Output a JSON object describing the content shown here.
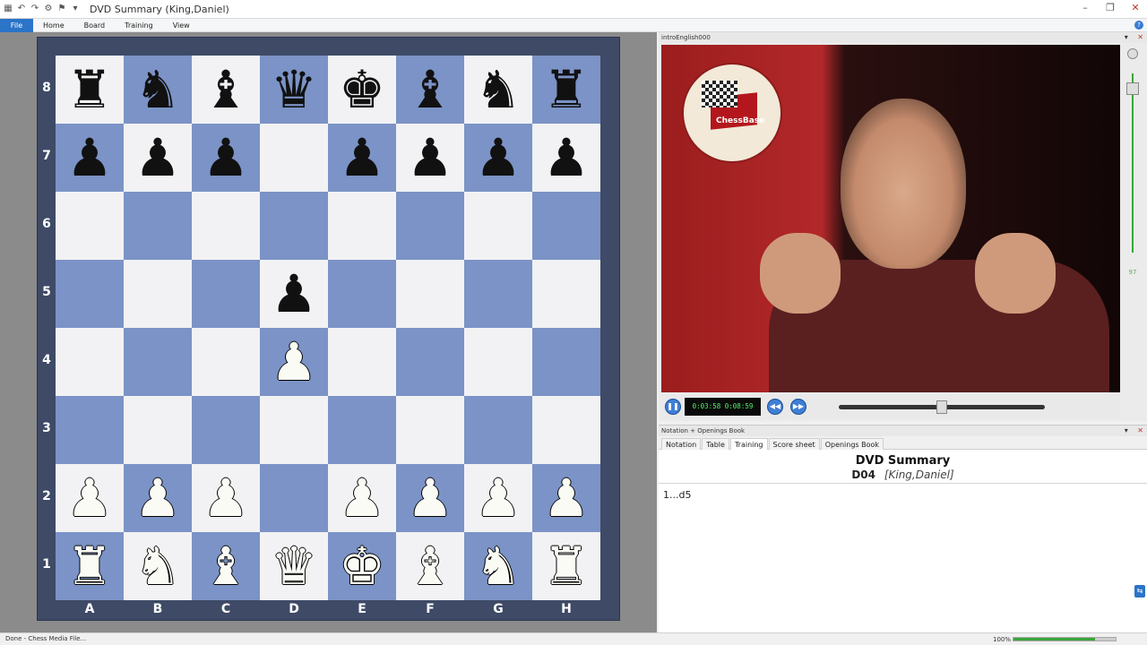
{
  "window": {
    "title": "DVD Summary  (King,Daniel)",
    "controls": [
      "minimize-icon",
      "restore-icon",
      "close-icon"
    ]
  },
  "quick_access": [
    "chessboard-icon",
    "undo-icon",
    "redo-icon",
    "engine-icon",
    "flag-icon",
    "dropdown-icon"
  ],
  "menu": {
    "items": [
      "File",
      "Home",
      "Board",
      "Training",
      "View"
    ]
  },
  "board": {
    "ranks": [
      "8",
      "7",
      "6",
      "5",
      "4",
      "3",
      "2",
      "1"
    ],
    "files": [
      "A",
      "B",
      "C",
      "D",
      "E",
      "F",
      "G",
      "H"
    ],
    "position": [
      [
        "br",
        "bn",
        "bb",
        "bq",
        "bk",
        "bb",
        "bn",
        "br"
      ],
      [
        "bp",
        "bp",
        "bp",
        "",
        "bp",
        "bp",
        "bp",
        "bp"
      ],
      [
        "",
        "",
        "",
        "",
        "",
        "",
        "",
        ""
      ],
      [
        "",
        "",
        "",
        "bp",
        "",
        "",
        "",
        ""
      ],
      [
        "",
        "",
        "",
        "wp",
        "",
        "",
        "",
        ""
      ],
      [
        "",
        "",
        "",
        "",
        "",
        "",
        "",
        ""
      ],
      [
        "wp",
        "wp",
        "wp",
        "",
        "wp",
        "wp",
        "wp",
        "wp"
      ],
      [
        "wr",
        "wn",
        "wb",
        "wq",
        "wk",
        "wb",
        "wn",
        "wr"
      ]
    ],
    "colors": {
      "light": "#f2f2f4",
      "dark": "#7b93c6",
      "frame": "#3e4a66"
    }
  },
  "video": {
    "pane_title": "introEnglish000",
    "logo_text": "ChessBase",
    "time": "0:03:58 0:08:59",
    "progress": 0.5,
    "volume": "97",
    "buttons": [
      "pause-icon",
      "rewind-icon",
      "fast-forward-icon"
    ]
  },
  "notation": {
    "pane_title": "Notation + Openings Book",
    "tabs": [
      "Notation",
      "Table",
      "Training",
      "Score sheet",
      "Openings Book"
    ],
    "active_tab": "Training",
    "title": "DVD Summary",
    "eco": "D04",
    "player": "[King,Daniel]",
    "moves": "1...d5"
  },
  "status": {
    "text": "Done - Chess Media File...",
    "zoom": "100%",
    "progress": 0.8
  }
}
